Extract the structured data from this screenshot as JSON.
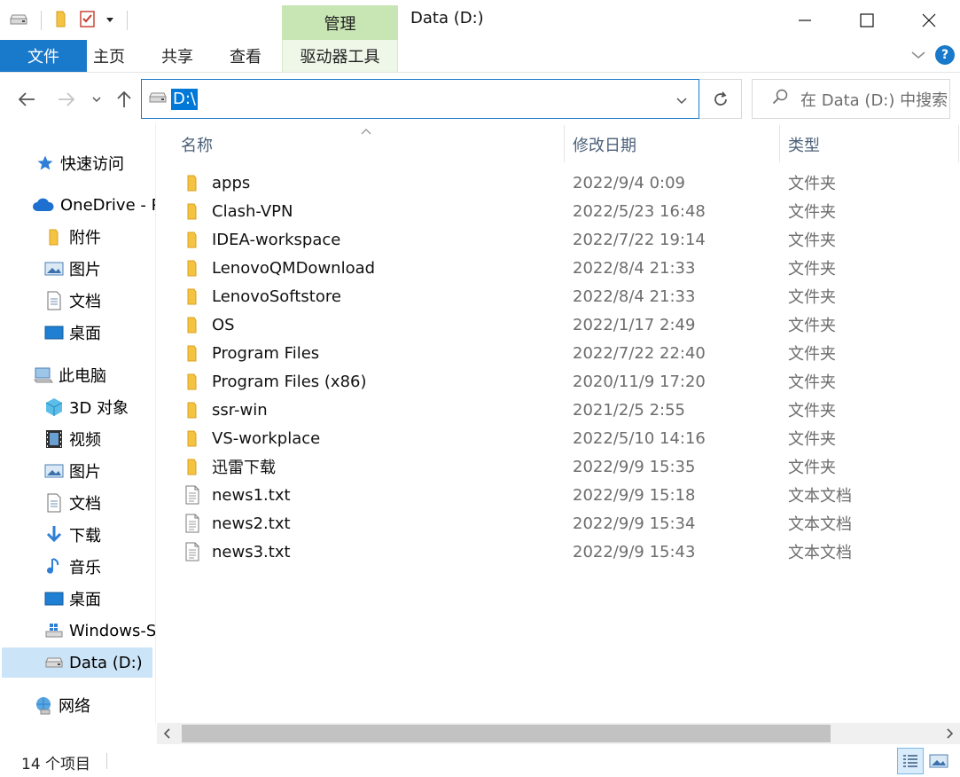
{
  "window": {
    "title": "Data (D:)",
    "contextual_group": "管理"
  },
  "ribbon": {
    "tabs": [
      {
        "label": "文件"
      },
      {
        "label": "主页"
      },
      {
        "label": "共享"
      },
      {
        "label": "查看"
      },
      {
        "label": "驱动器工具"
      }
    ]
  },
  "address": {
    "path": "D:\\",
    "search_placeholder": "在 Data (D:) 中搜索"
  },
  "nav": {
    "items": [
      {
        "label": "快速访问",
        "icon": "star-icon"
      },
      {
        "label": "OneDrive - P",
        "icon": "cloud-icon"
      },
      {
        "label": "附件",
        "icon": "folder-icon"
      },
      {
        "label": "图片",
        "icon": "pictures-icon"
      },
      {
        "label": "文档",
        "icon": "document-icon"
      },
      {
        "label": "桌面",
        "icon": "desktop-icon"
      },
      {
        "label": "此电脑",
        "icon": "computer-icon"
      },
      {
        "label": "3D 对象",
        "icon": "cube-icon"
      },
      {
        "label": "视频",
        "icon": "video-icon"
      },
      {
        "label": "图片",
        "icon": "pictures-icon"
      },
      {
        "label": "文档",
        "icon": "document-icon"
      },
      {
        "label": "下载",
        "icon": "download-icon"
      },
      {
        "label": "音乐",
        "icon": "music-icon"
      },
      {
        "label": "桌面",
        "icon": "desktop-icon"
      },
      {
        "label": "Windows-SSD",
        "icon": "system-drive-icon"
      },
      {
        "label": "Data (D:)",
        "icon": "drive-icon",
        "selected": true
      },
      {
        "label": "网络",
        "icon": "network-icon"
      }
    ]
  },
  "files": {
    "columns": {
      "name": "名称",
      "date": "修改日期",
      "type": "类型"
    },
    "rows": [
      {
        "name": "apps",
        "date": "2022/9/4 0:09",
        "type": "文件夹",
        "kind": "folder"
      },
      {
        "name": "Clash-VPN",
        "date": "2022/5/23 16:48",
        "type": "文件夹",
        "kind": "folder"
      },
      {
        "name": "IDEA-workspace",
        "date": "2022/7/22 19:14",
        "type": "文件夹",
        "kind": "folder"
      },
      {
        "name": "LenovoQMDownload",
        "date": "2022/8/4 21:33",
        "type": "文件夹",
        "kind": "folder"
      },
      {
        "name": "LenovoSoftstore",
        "date": "2022/8/4 21:33",
        "type": "文件夹",
        "kind": "folder"
      },
      {
        "name": "OS",
        "date": "2022/1/17 2:49",
        "type": "文件夹",
        "kind": "folder"
      },
      {
        "name": "Program Files",
        "date": "2022/7/22 22:40",
        "type": "文件夹",
        "kind": "folder"
      },
      {
        "name": "Program Files (x86)",
        "date": "2020/11/9 17:20",
        "type": "文件夹",
        "kind": "folder"
      },
      {
        "name": "ssr-win",
        "date": "2021/2/5 2:55",
        "type": "文件夹",
        "kind": "folder"
      },
      {
        "name": "VS-workplace",
        "date": "2022/5/10 14:16",
        "type": "文件夹",
        "kind": "folder"
      },
      {
        "name": "迅雷下载",
        "date": "2022/9/9 15:35",
        "type": "文件夹",
        "kind": "folder"
      },
      {
        "name": "news1.txt",
        "date": "2022/9/9 15:18",
        "type": "文本文档",
        "kind": "text"
      },
      {
        "name": "news2.txt",
        "date": "2022/9/9 15:34",
        "type": "文本文档",
        "kind": "text"
      },
      {
        "name": "news3.txt",
        "date": "2022/9/9 15:43",
        "type": "文本文档",
        "kind": "text"
      }
    ]
  },
  "status": {
    "count": "14 个项目"
  },
  "colors": {
    "accent": "#1979ca",
    "selection": "#cce4f7",
    "manage_tab": "#c8e6b4",
    "folder": "#f5c342"
  }
}
